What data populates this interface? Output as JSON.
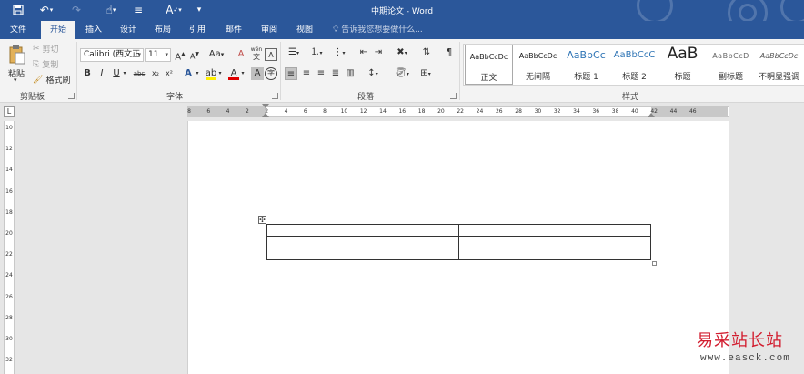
{
  "window": {
    "title": "中期论文 - Word"
  },
  "tabs": [
    {
      "label": "文件",
      "active": false
    },
    {
      "label": "开始",
      "active": true
    },
    {
      "label": "插入",
      "active": false
    },
    {
      "label": "设计",
      "active": false
    },
    {
      "label": "布局",
      "active": false
    },
    {
      "label": "引用",
      "active": false
    },
    {
      "label": "邮件",
      "active": false
    },
    {
      "label": "审阅",
      "active": false
    },
    {
      "label": "视图",
      "active": false
    }
  ],
  "tell_me": {
    "placeholder": "告诉我您想要做什么..."
  },
  "ribbon": {
    "clipboard": {
      "paste": "粘贴",
      "cut": "剪切",
      "copy": "复制",
      "format_painter": "格式刷",
      "label": "剪贴板"
    },
    "font": {
      "name": "Calibri (西文正",
      "size": "11",
      "label": "字体",
      "change_case": "Aa",
      "grow": "A",
      "shrink": "A",
      "bold": "B",
      "italic": "I",
      "underline": "U",
      "strike": "abc",
      "sub": "x₂",
      "sup": "x²",
      "font_color": "A",
      "char_shading": "A",
      "enclosed": "字",
      "wen": "wén",
      "wen_char": "文"
    },
    "paragraph": {
      "label": "段落"
    },
    "styles": {
      "label": "样式",
      "items": [
        {
          "sample": "AaBbCcDc",
          "name": "正文",
          "selected": true
        },
        {
          "sample": "AaBbCcDc",
          "name": "无间隔",
          "selected": false
        },
        {
          "sample": "AaBbCc",
          "name": "标题 1",
          "selected": false
        },
        {
          "sample": "AaBbCcC",
          "name": "标题 2",
          "selected": false
        },
        {
          "sample": "AaB",
          "name": "标题",
          "selected": false
        },
        {
          "sample": "AaBbCcD",
          "name": "副标题",
          "selected": false
        },
        {
          "sample": "AaBbCcDc",
          "name": "不明显强调",
          "selected": false
        }
      ]
    }
  },
  "ruler": {
    "horizontal_ticks": [
      "8",
      "6",
      "4",
      "2",
      "2",
      "4",
      "6",
      "8",
      "10",
      "12",
      "14",
      "16",
      "18",
      "20",
      "22",
      "24",
      "26",
      "28",
      "30",
      "32",
      "34",
      "36",
      "38",
      "40",
      "42",
      "44",
      "46"
    ],
    "vertical_ticks": [
      "10",
      "12",
      "14",
      "16",
      "18",
      "20",
      "22",
      "24",
      "26",
      "28",
      "30",
      "32"
    ],
    "corner": "L"
  },
  "document": {
    "table": {
      "rows": 3,
      "cols": 2,
      "cells": [
        [
          "",
          ""
        ],
        [
          "",
          ""
        ],
        [
          "",
          ""
        ]
      ]
    }
  },
  "watermark": {
    "site_name": "易采站长站",
    "url": "www.easck.com"
  }
}
